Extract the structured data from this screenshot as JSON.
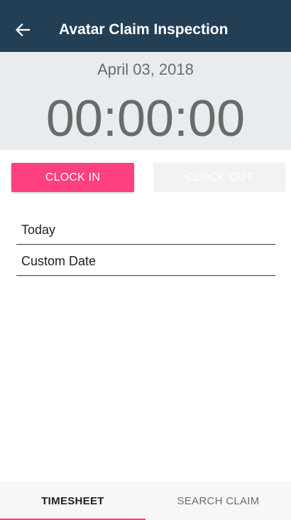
{
  "app_bar": {
    "title": "Avatar Claim Inspection",
    "back_icon": "arrow-left-icon",
    "background": "#233f55"
  },
  "clock": {
    "date": "April 03, 2018",
    "time": "00:00:00"
  },
  "actions": {
    "clock_in_label": "CLOCK IN",
    "clock_out_label": "CLOCK OUT",
    "clock_in_color": "#ff4081",
    "clock_out_disabled": true
  },
  "date_options": [
    {
      "label": "Today"
    },
    {
      "label": "Custom Date"
    }
  ],
  "bottom_nav": {
    "tabs": [
      {
        "label": "TIMESHEET",
        "selected": true
      },
      {
        "label": "SEARCH CLAIM",
        "selected": false
      }
    ],
    "indicator_color": "#ff4081"
  }
}
